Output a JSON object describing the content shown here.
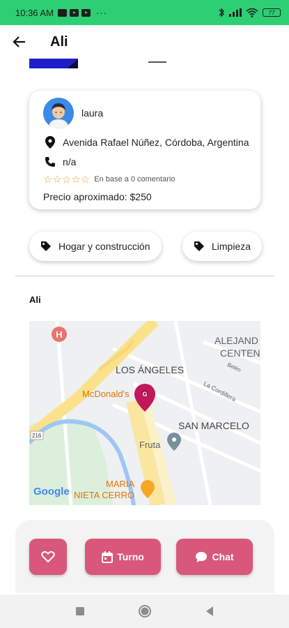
{
  "status_bar": {
    "time": "10:36 AM",
    "more": "···",
    "battery": "77"
  },
  "app_bar": {
    "title": "Ali"
  },
  "profile": {
    "name": "laura",
    "address": "Avenida Rafael Núñez, Córdoba, Argentina",
    "phone": "n/a",
    "stars": "☆☆☆☆☆",
    "rating_text": "En base a 0 comentario",
    "price": "Precio aproximado: $250"
  },
  "categories": [
    {
      "label": "Hogar y construcción"
    },
    {
      "label": "Limpieza"
    }
  ],
  "location": {
    "title": "Ali"
  },
  "map": {
    "labels": {
      "alejandro": "ALEJAND",
      "centen": "CENTEN",
      "los_angeles": "LOS ÁNGELES",
      "mcdonalds": "McDonald's",
      "san_marcelo": "SAN MARCELO",
      "fruta": "Fruta",
      "maria": "MARIA",
      "nieta_cerro": "NIETA CERRO",
      "la_cordillera": "La Cordillera",
      "belen": "Belén",
      "route": "216",
      "google": "Google"
    },
    "marker_letter": "G"
  },
  "actions": {
    "turno": "Turno",
    "chat": "Chat"
  },
  "colors": {
    "status_bar": "#2ccf73",
    "accent": "#d9577b",
    "star": "#f1a22b"
  }
}
